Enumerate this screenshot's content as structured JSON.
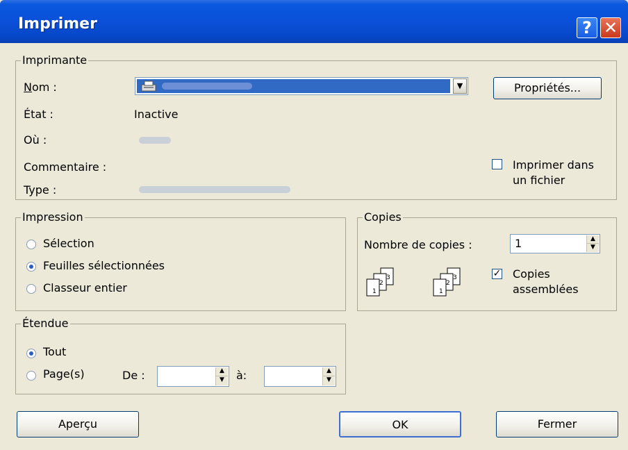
{
  "window": {
    "title": "Imprimer",
    "help_button": "?",
    "close_button": "✕"
  },
  "printer": {
    "legend": "Imprimante",
    "name_label": "Nom :",
    "status_label": "État :",
    "status_value": "Inactive",
    "where_label": "Où :",
    "comment_label": "Commentaire :",
    "type_label": "Type :",
    "properties_button": "Propriétés...",
    "print_to_file_line1": "Imprimer dans",
    "print_to_file_line2": "un fichier",
    "print_to_file_checked": false
  },
  "print_what": {
    "legend": "Impression",
    "options": [
      "Sélection",
      "Feuilles sélectionnées",
      "Classeur entier"
    ],
    "selected_index": 1
  },
  "copies": {
    "legend": "Copies",
    "count_label": "Nombre de copies :",
    "count_value": "1",
    "collate_line1": "Copies",
    "collate_line2": "assemblées",
    "collate_checked": true
  },
  "range": {
    "legend": "Étendue",
    "all_label": "Tout",
    "pages_label": "Page(s)",
    "from_label": "De :",
    "to_label": "à:",
    "from_value": "",
    "to_value": "",
    "selected": "all"
  },
  "buttons": {
    "preview": "Aperçu",
    "ok": "OK",
    "close": "Fermer"
  },
  "colors": {
    "titlebar": "#0a50d8",
    "dialog_bg": "#ece9d8",
    "selection": "#316ac5"
  }
}
